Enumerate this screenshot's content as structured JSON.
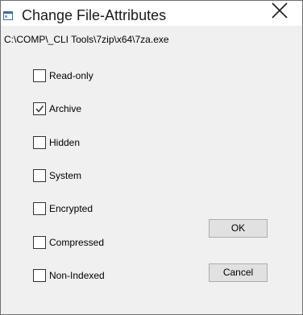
{
  "window": {
    "title": "Change File-Attributes",
    "app_icon": "window-app-icon",
    "close_icon": "close-icon"
  },
  "file_path": "C:\\COMP\\_CLI Tools\\7zip\\x64\\7za.exe",
  "attributes": [
    {
      "label": "Read-only",
      "checked": false
    },
    {
      "label": "Archive",
      "checked": true
    },
    {
      "label": "Hidden",
      "checked": false
    },
    {
      "label": "System",
      "checked": false
    },
    {
      "label": "Encrypted",
      "checked": false
    },
    {
      "label": "Compressed",
      "checked": false
    },
    {
      "label": "Non-Indexed",
      "checked": false
    }
  ],
  "buttons": {
    "ok_label": "OK",
    "cancel_label": "Cancel"
  }
}
